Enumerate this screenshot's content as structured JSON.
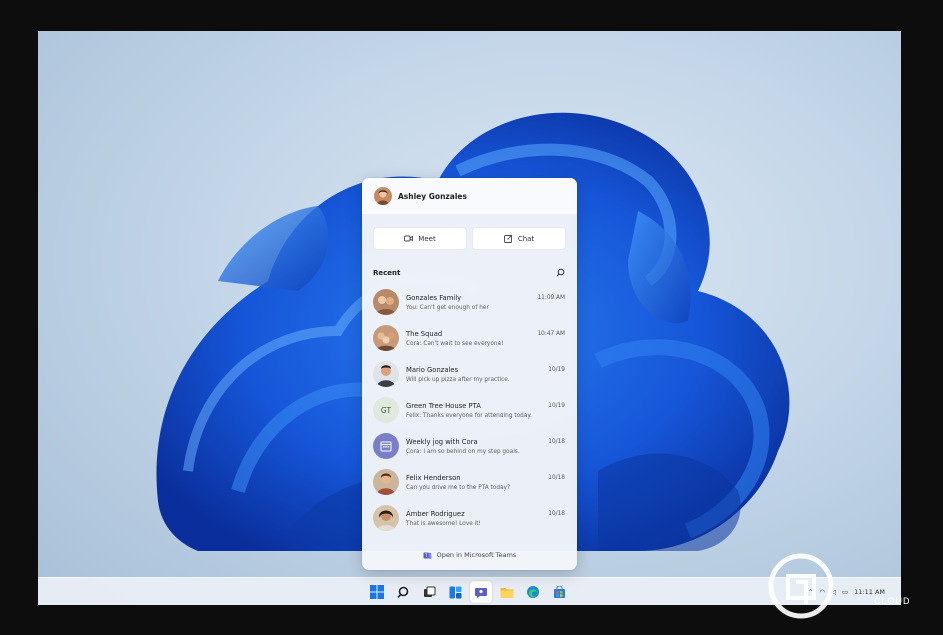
{
  "user": {
    "name": "Ashley Gonzales"
  },
  "actions": {
    "meet_label": "Meet",
    "chat_label": "Chat"
  },
  "recent": {
    "label": "Recent"
  },
  "chats": [
    {
      "name": "Gonzales Family",
      "time": "11:09 AM",
      "message": "You: Can't get enough of her",
      "avatar": "photo"
    },
    {
      "name": "The Squad",
      "time": "10:47 AM",
      "message": "Cora: Can't wait to see everyone!",
      "avatar": "photo"
    },
    {
      "name": "Mario Gonzales",
      "time": "10/19",
      "message": "Will pick up pizza after my practice.",
      "avatar": "photo"
    },
    {
      "name": "Green Tree House PTA",
      "time": "10/19",
      "message": "Felix: Thanks everyone for attending today.",
      "avatar": "GT"
    },
    {
      "name": "Weekly jog with Cora",
      "time": "10/18",
      "message": "Cora: I am so behind on my step goals.",
      "avatar": "calendar-icon"
    },
    {
      "name": "Felix Henderson",
      "time": "10/18",
      "message": "Can you drive me to the PTA today?",
      "avatar": "photo"
    },
    {
      "name": "Amber Rodriguez",
      "time": "10/18",
      "message": "That is awesome! Love it!",
      "avatar": "photo"
    }
  ],
  "footer": {
    "open_teams_label": "Open in Microsoft Teams"
  },
  "tray": {
    "time": "11:11 AM"
  },
  "watermark": {
    "text": "CLOUD"
  },
  "colors": {
    "accent": "#1a5fd6",
    "teams": "#5b5fc7",
    "gt_badge": "#dfe9dc"
  }
}
